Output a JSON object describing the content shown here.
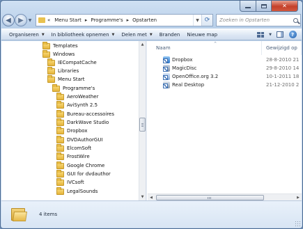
{
  "address": {
    "crumbs": [
      "Menu Start",
      "Programme's",
      "Opstarten"
    ],
    "prefix": "«"
  },
  "search": {
    "placeholder": "Zoeken in Opstarten"
  },
  "toolbar": {
    "organize": "Organiseren",
    "library": "In bibliotheek opnemen",
    "share": "Delen met",
    "burn": "Branden",
    "new_folder": "Nieuwe map"
  },
  "tree": [
    "Templates",
    "Windows",
    "IECompatCache",
    "Libraries",
    "Menu Start",
    "Programme's",
    "AeroWeather",
    "AviSynth 2.5",
    "Bureau-accessoires",
    "DarkWave Studio",
    "Dropbox",
    "DVDAuthorGUI",
    "ElcomSoft",
    "FrostWire",
    "Google Chrome",
    "GUI for dvdauthor",
    "IVCsoft",
    "LegalSounds"
  ],
  "columns": {
    "name": "Naam",
    "date": "Gewijzigd op"
  },
  "files": [
    {
      "name": "Dropbox",
      "date": "28-8-2010 21",
      "icon": "dropbox-shortcut-icon"
    },
    {
      "name": "MagicDisc",
      "date": "29-8-2010 14",
      "icon": "magicdisc-shortcut-icon"
    },
    {
      "name": "OpenOffice.org 3.2",
      "date": "10-1-2011 18",
      "icon": "openoffice-shortcut-icon"
    },
    {
      "name": "Real Desktop",
      "date": "21-12-2010 2",
      "icon": "realdesktop-shortcut-icon"
    }
  ],
  "status": {
    "count": "4 items"
  },
  "colors": {
    "folder": "#e9bd45",
    "close": "#c4402a",
    "chrome": "#c6d8ee"
  }
}
